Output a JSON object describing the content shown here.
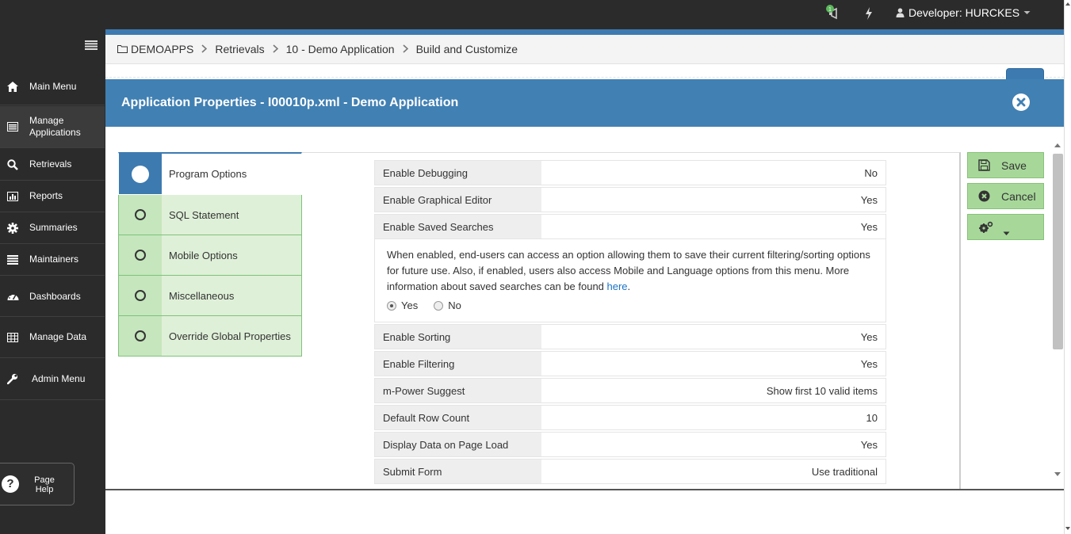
{
  "topbar": {
    "notification_badge": "1",
    "user_label": "Developer: HURCKES"
  },
  "sidebar": {
    "items": [
      {
        "label": "Main Menu",
        "icon": "home-icon"
      },
      {
        "label": "Manage Applications",
        "icon": "applications-icon"
      },
      {
        "label": "Retrievals",
        "icon": "search-icon"
      },
      {
        "label": "Reports",
        "icon": "bar-chart-icon"
      },
      {
        "label": "Summaries",
        "icon": "gear-icon"
      },
      {
        "label": "Maintainers",
        "icon": "list-icon"
      },
      {
        "label": "Dashboards",
        "icon": "dashboard-icon"
      },
      {
        "label": "Manage Data",
        "icon": "table-icon"
      },
      {
        "label": "Admin Menu",
        "icon": "wrench-icon"
      }
    ],
    "page_help": {
      "line1": "Page",
      "line2": "Help"
    }
  },
  "breadcrumb": [
    "DEMOAPPS",
    "Retrievals",
    "10 - Demo Application",
    "Build and Customize"
  ],
  "modal": {
    "title": "Application Properties - I00010p.xml - Demo Application"
  },
  "tabs": [
    {
      "label": "Program Options",
      "active": true
    },
    {
      "label": "SQL Statement",
      "active": false
    },
    {
      "label": "Mobile Options",
      "active": false
    },
    {
      "label": "Miscellaneous",
      "active": false
    },
    {
      "label": "Override Global Properties",
      "active": false
    }
  ],
  "properties": [
    {
      "key": "Enable Debugging",
      "value": "No"
    },
    {
      "key": "Enable Graphical Editor",
      "value": "Yes"
    },
    {
      "key": "Enable Saved Searches",
      "value": "Yes"
    },
    {
      "key": "Enable Sorting",
      "value": "Yes"
    },
    {
      "key": "Enable Filtering",
      "value": "Yes"
    },
    {
      "key": "m-Power Suggest",
      "value": "Show first 10 valid items"
    },
    {
      "key": "Default Row Count",
      "value": "10"
    },
    {
      "key": "Display Data on Page Load",
      "value": "Yes"
    },
    {
      "key": "Submit Form",
      "value": "Use traditional"
    }
  ],
  "saved_search_help": {
    "text": "When enabled, end-users can access an option allowing them to save their current filtering/sorting options for future use. Also, if enabled, users also access Mobile and Language options from this menu. More information about saved searches can be found ",
    "link": "here",
    "after_link": ".",
    "option_yes": "Yes",
    "option_no": "No",
    "selected": "Yes"
  },
  "actions": {
    "save": "Save",
    "cancel": "Cancel"
  },
  "colors": {
    "accent_blue": "#4180b3",
    "tab_green": "#dff0d8",
    "button_green": "#a7d89a",
    "dark_bg": "#2b2b2b"
  }
}
